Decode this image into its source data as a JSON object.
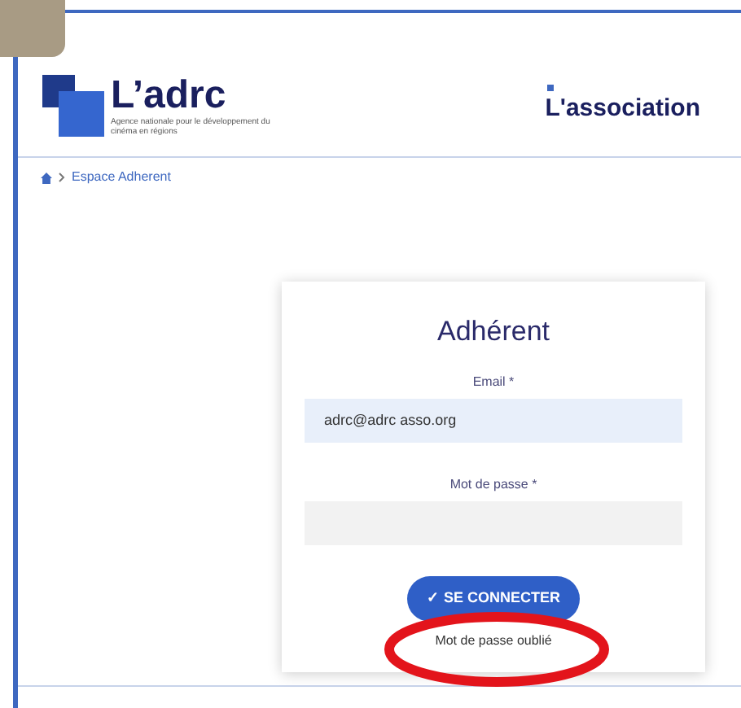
{
  "header": {
    "logo_name": "L’adrc",
    "logo_tagline": "Agence nationale pour le développement du cinéma en régions",
    "nav_link": "L'association"
  },
  "breadcrumb": {
    "current": "Espace Adherent"
  },
  "login": {
    "title": "Adhérent",
    "email_label": "Email *",
    "email_value": "adrc@adrc asso.org",
    "password_label": "Mot de passe *",
    "submit": "✓ SE CONNECTER",
    "forgot": "Mot de passe oublié"
  }
}
